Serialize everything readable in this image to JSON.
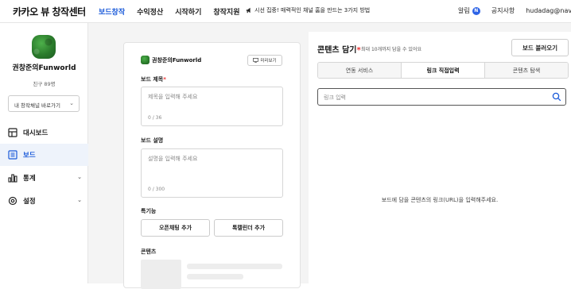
{
  "header": {
    "brand": "카카오 뷰 창작센터",
    "nav": [
      {
        "label": "보드창작",
        "active": true
      },
      {
        "label": "수익정산",
        "active": false
      },
      {
        "label": "시작하기",
        "active": false
      },
      {
        "label": "창작지원",
        "active": false
      }
    ],
    "notice": "시선 집중! 매력적인 채널 홈을 만드는 3가지 방법",
    "alarm_label": "알림",
    "alarm_badge": "N",
    "notices_label": "공지사항",
    "email": "hudadag@nave"
  },
  "sidebar": {
    "channel_name": "권창준의Funworld",
    "friends": "친구 89명",
    "channel_select": "내 창작채널 바로가기",
    "menu": [
      {
        "label": "대시보드",
        "icon": "dashboard-icon",
        "active": false,
        "has_arrow": false
      },
      {
        "label": "보드",
        "icon": "board-icon",
        "active": true,
        "has_arrow": false
      },
      {
        "label": "통계",
        "icon": "stats-icon",
        "active": false,
        "has_arrow": true
      },
      {
        "label": "설정",
        "icon": "settings-icon",
        "active": false,
        "has_arrow": true
      }
    ]
  },
  "board": {
    "channel_name": "권창준의Funworld",
    "preview_label": "미리보기",
    "title_label": "보드 제목",
    "title_placeholder": "제목을 입력해 주세요",
    "title_count": "0 / 36",
    "desc_label": "보드 설명",
    "desc_placeholder": "설명을 입력해 주세요",
    "desc_count": "0 / 300",
    "features_label": "특기능",
    "openchat_btn": "오픈채팅 추가",
    "talkcalendar_btn": "톡캘린더 추가",
    "contents_label": "콘텐츠"
  },
  "content_panel": {
    "title": "콘텐츠 담기",
    "subtitle": "최대 10개까지 담을 수 있어요",
    "load_btn": "보드 불러오기",
    "tabs": [
      {
        "label": "연동 서비스",
        "active": false
      },
      {
        "label": "링크 직접입력",
        "active": true
      },
      {
        "label": "콘텐츠 탐색",
        "active": false
      }
    ],
    "link_placeholder": "링크 입력",
    "empty_message": "보드에 담을 콘텐츠의 링크(URL)을 입력해주세요."
  },
  "colors": {
    "accent": "#1a5ad9",
    "required": "#e33333",
    "badge": "#2d63e6"
  }
}
